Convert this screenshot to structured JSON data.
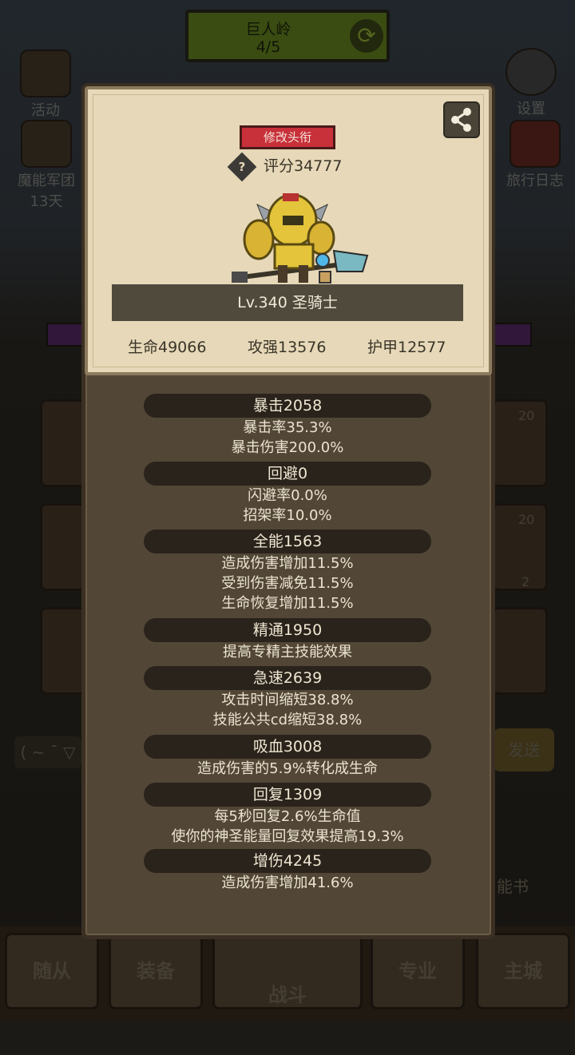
{
  "background": {
    "zone_title": "巨人岭",
    "zone_progress": "4/5",
    "left_buttons": [
      {
        "label": "活动",
        "icon": "event-book-icon"
      },
      {
        "label": "魔能军团",
        "sub": "13天",
        "icon": "legion-helmet-icon"
      }
    ],
    "right_buttons": [
      {
        "label": "设置",
        "icon": "gear-icon"
      },
      {
        "label": "旅行日志",
        "icon": "journal-icon"
      }
    ],
    "chat_text": "( ~ ¯ ▽",
    "send_fragment": "发送",
    "skill_book_fragment": "能书",
    "slot_badges": [
      "20",
      "20",
      "2"
    ],
    "nav_tabs": [
      "随从",
      "装备",
      "战斗",
      "专业",
      "主城"
    ]
  },
  "card": {
    "edit_title_label": "修改头衔",
    "score_label": "评分34777",
    "level_class": "Lv.340 圣骑士",
    "hp": "生命49066",
    "attack": "攻强13576",
    "armor": "护甲12577"
  },
  "stats": [
    {
      "header": "暴击2058",
      "lines": [
        "暴击率35.3%",
        "暴击伤害200.0%"
      ]
    },
    {
      "header": "回避0",
      "lines": [
        "闪避率0.0%",
        "招架率10.0%"
      ]
    },
    {
      "header": "全能1563",
      "lines": [
        "造成伤害增加11.5%",
        "受到伤害减免11.5%",
        "生命恢复增加11.5%"
      ]
    },
    {
      "header": "精通1950",
      "lines": [
        "提高专精主技能效果"
      ]
    },
    {
      "header": "急速2639",
      "lines": [
        "攻击时间缩短38.8%",
        "技能公共cd缩短38.8%"
      ]
    },
    {
      "header": "吸血3008",
      "lines": [
        "造成伤害的5.9%转化成生命"
      ]
    },
    {
      "header": "回复1309",
      "lines": [
        "每5秒回复2.6%生命值",
        "使你的神圣能量回复效果提高19.3%"
      ]
    },
    {
      "header": "增伤4245",
      "lines": [
        "造成伤害增加41.6%"
      ]
    }
  ],
  "colors": {
    "title_button": "#c8303a",
    "card_bg": "#e6d8b8",
    "panel_bg": "#524737",
    "header_pill": "#2a231b"
  }
}
